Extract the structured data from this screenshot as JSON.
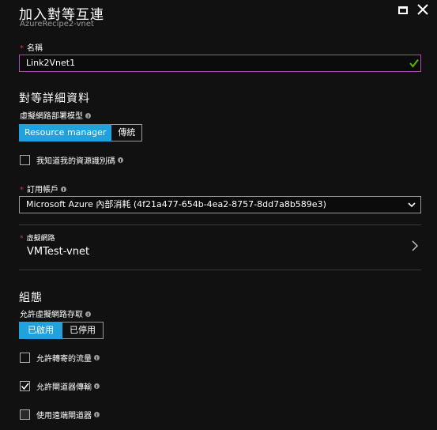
{
  "header": {
    "title": "加入對等互連",
    "subtitle": "AzureRecipe2-vnet"
  },
  "name_field": {
    "label": "名稱",
    "required_mark": "*",
    "value": "Link2Vnet1"
  },
  "peer_details": {
    "section_title": "對等詳細資料",
    "deployment_model_label": "虛擬網路部署模型",
    "deployment_options": [
      "Resource manager",
      "傳統"
    ],
    "deployment_selected": "Resource manager",
    "know_resource_id_label": "我知道我的資源識別碼",
    "know_resource_id_checked": false,
    "subscription_label": "訂用帳戶",
    "subscription_value": "Microsoft Azure 內部消耗 (4f21a477-654b-4ea2-8757-8dd7a8b589e3)",
    "vnet_label": "虛擬網路",
    "vnet_value": "VMTest-vnet"
  },
  "configuration": {
    "section_title": "組態",
    "allow_vnet_access_label": "允許虛擬網路存取",
    "vnet_access_options": [
      "已啟用",
      "已停用"
    ],
    "vnet_access_selected": "已啟用",
    "allow_forwarded_traffic_label": "允許轉寄的流量",
    "allow_forwarded_traffic_checked": false,
    "allow_gateway_transit_label": "允許閘道器傳輸",
    "allow_gateway_transit_checked": true,
    "use_remote_gateways_label": "使用遠端閘道器",
    "use_remote_gateways_checked": false
  },
  "colors": {
    "accent": "#1fa2de",
    "required": "#e2323a",
    "valid_check": "#5db300",
    "input_focus_border": "#b24bb2"
  }
}
